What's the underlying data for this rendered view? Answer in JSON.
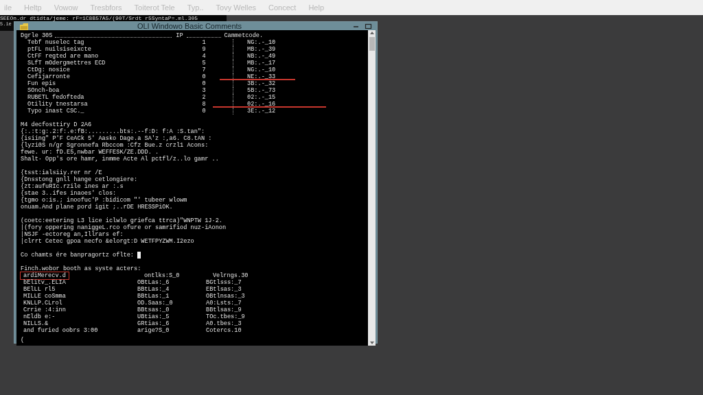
{
  "menu": [
    "ile",
    "Heltp",
    "Vowow",
    "Tresbfors",
    "Toiterot Tele",
    "Typ..",
    "Tovy Welles",
    "Concect",
    "Help"
  ],
  "path_bar": "SEEOn.dr dtidta/jeme: rF=1C8B57A5/(90T/Srdt r5SyntaP=.ml.305",
  "side_text": "5.ie",
  "window": {
    "title": "OLI Windowo Basic Comments",
    "buttons": [
      {
        "kind": "minimize"
      },
      {
        "kind": "maximize"
      }
    ]
  },
  "console": {
    "table": {
      "header": {
        "name": "Dgrle 305",
        "ip": "IP",
        "code": "Cammetcode."
      },
      "rows": [
        {
          "name": "Tebf nuselec tag",
          "ip": "1",
          "code": "NG:.-_10",
          "struck": false
        },
        {
          "name": "ptFL nuilsiseixcte",
          "ip": "9",
          "code": "MB:.-_39",
          "struck": false
        },
        {
          "name": "CtFF regted are mano",
          "ip": "4",
          "code": "NB:.-_49",
          "struck": false
        },
        {
          "name": "SLfT mOdergmettres ECD",
          "ip": "5",
          "code": "MB:.-_17",
          "struck": false
        },
        {
          "name": "CtDg: nosice",
          "ip": "7",
          "code": "NG:.-_10",
          "struck": false
        },
        {
          "name": "Cefijarronte",
          "ip": "0",
          "code": "NE:.-_33",
          "struck": true
        },
        {
          "name": "Fun epis",
          "ip": "0",
          "code": "3B:.-_32",
          "struck": false
        },
        {
          "name": "SOnch-boa",
          "ip": "3",
          "code": "5B:.-_73",
          "struck": false
        },
        {
          "name": "RUBETL fedofteda",
          "ip": "2",
          "code": "02:.-_15",
          "struck": false
        },
        {
          "name": "Otility tnestarsa",
          "ip": "8",
          "code": "02:.-_16",
          "struck": true
        },
        {
          "name": "Typo inast CSC._",
          "ip": "0",
          "code": "3E:.-_12",
          "struck": false
        }
      ]
    },
    "paragraphs": [
      [
        "M4 decfosttiry D 2A6",
        "{:.:t:g:.2:f:.e:fB:.........bts:.--f:D: f:A :S.tan\":",
        "{isiing\" P'F CeACk 5' Aasko Dage.a SA'z :,a6. C8.tAN :",
        "{lyzi0S n/gr Sgronnefa Rbccom :Cfz Bue.z crzl1 Acons:",
        "fewe. ur: fD.E5,nwbar WEFFESK/ZE.DDD. .",
        "Shalt· Opp's ore hamr, inmme Acte Al pctfl/z..lo gamr .."
      ],
      [
        "{tsst:ialsiiy.rer nr /E",
        "{Dnsstong gnll hange cetlongiere:",
        "{zt:aufuRIc.rzile ines ar :.s",
        "{stae 3..ifes inaoes' clos:",
        "{tgmo o:is.; inoofuc'P :bidicom \"' tubeer wlowm",
        "onuam.And plane pord igit ;..rDE HRESSPiOK."
      ],
      [
        "(coetc:eetering L3 lice iclwlo griefca ttrca)\"WNPTW 1J·2.",
        "|(fory oppering naniggeL.rco ofure or samrifiod nuz-iAonon",
        "|NSJF -ectoreg an,Illrars ef:",
        "|clrrt Cetec gpoa necfo &elorgt:D WETFPYZWM.I2ezo"
      ]
    ],
    "prompt": "Co chamts ére banpragortz oflte:",
    "list": {
      "heading": "Finch.wobor booth as syste acters:",
      "rows": [
        {
          "name": "ardiMerecv.d",
          "col2": "ontlks:S_0",
          "col3": "Velrngs.30",
          "boxed": true
        },
        {
          "name": "bElitv_.ELIA",
          "col2": "OBtLas:_6",
          "col3": "BGtlsss:_7",
          "boxed": false
        },
        {
          "name": "BElLL rl5",
          "col2": "BBtLas:_4",
          "col3": "EBtlsas:_3",
          "boxed": false
        },
        {
          "name": "MILLE coSmma",
          "col2": "BBtLas:_1",
          "col3": "OBtlnsas:_3",
          "boxed": false
        },
        {
          "name": "KNLLP.CLrol",
          "col2": "OD.Saas:_0",
          "col3": "A0:Lsts:_7",
          "boxed": false
        },
        {
          "name": "Crrie :4:inn",
          "col2": "BBtsas:_0",
          "col3": "BBtlsas:_9",
          "boxed": false
        },
        {
          "name": "nEldb e:-",
          "col2": "UBtias:_5",
          "col3": "TOc.tbes:_9",
          "boxed": false
        },
        {
          "name": "NILLS.&",
          "col2": "GRtias:_6",
          "col3": "A0.tbes:_3",
          "boxed": false
        },
        {
          "name": "and furied oobrs 3:00",
          "col2": "arige?S_0",
          "col3": "Cotercs.10",
          "boxed": false
        }
      ]
    },
    "last_line": "("
  }
}
